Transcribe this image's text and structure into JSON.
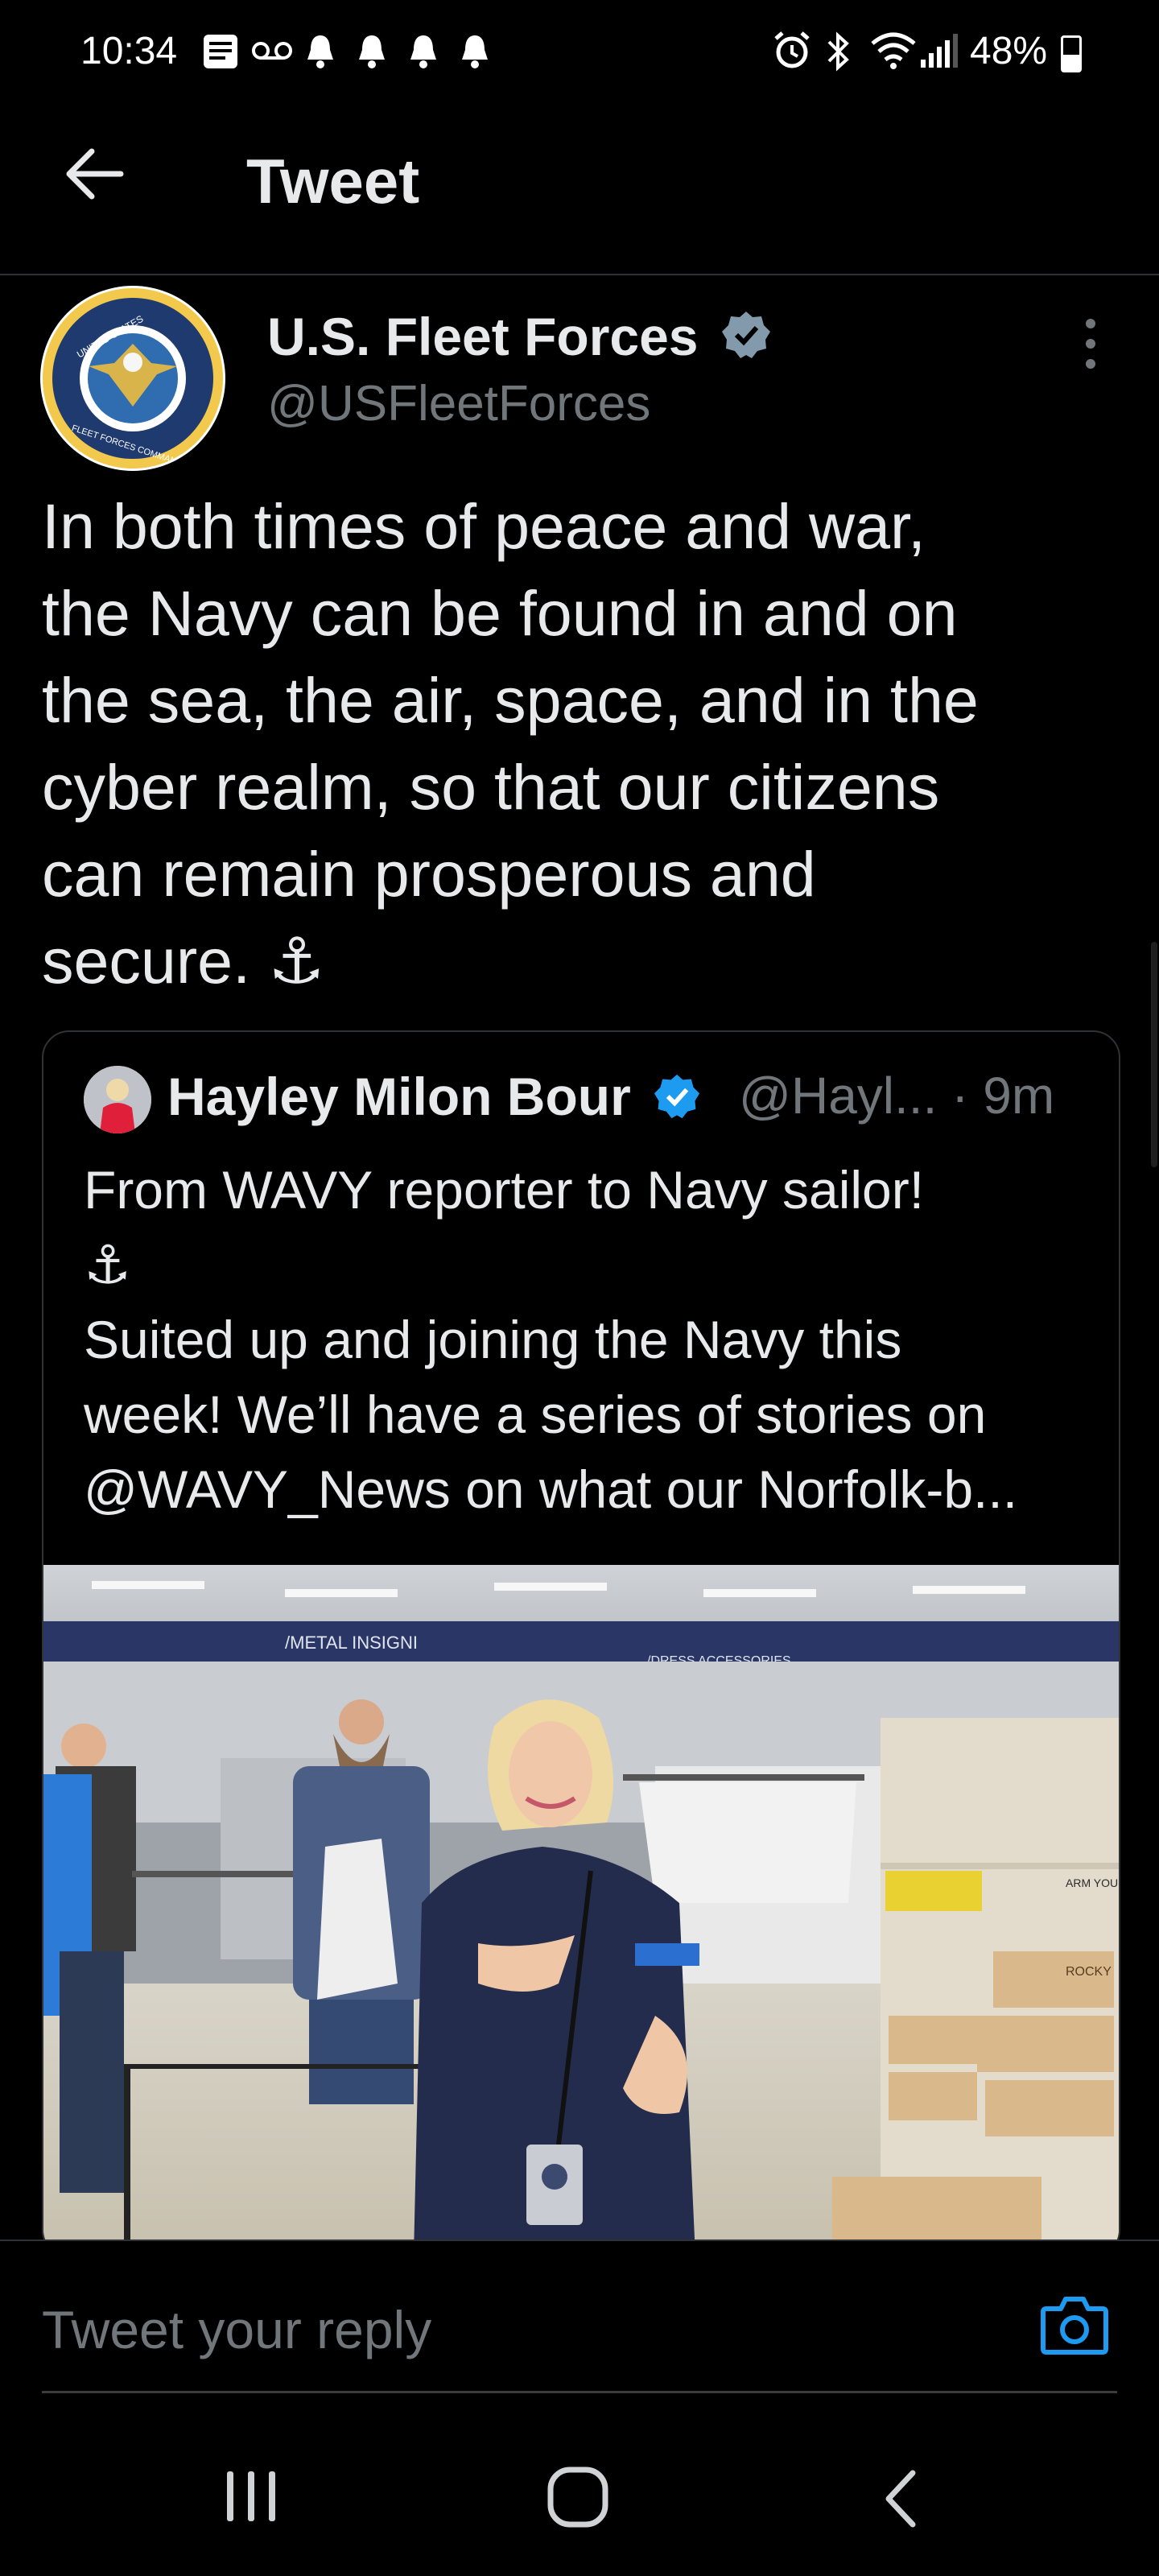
{
  "status_bar": {
    "time": "10:34",
    "battery": "48%",
    "battery_level": 0.48,
    "icons": [
      "message-icon",
      "voicemail-icon",
      "bell-icon",
      "bell-icon",
      "bell-icon",
      "bell-icon",
      "alarm-icon",
      "bluetooth-icon",
      "wifi-icon",
      "signal-icon",
      "battery-icon"
    ]
  },
  "header": {
    "title": "Tweet",
    "back_icon": "back-arrow-icon"
  },
  "tweet": {
    "author_name": "U.S. Fleet Forces",
    "author_handle": "@USFleetForces",
    "avatar_text_top": "UNITED STATES",
    "avatar_text_bottom": "FLEET FORCES COMMAND",
    "text_lines": [
      "In both times of peace and war,",
      "the Navy can be found in and on",
      "the sea, the air, space, and in the",
      "cyber realm, so that our citizens",
      "can remain prosperous and",
      "secure. ⚓"
    ],
    "verified_color": "#829aab"
  },
  "quote": {
    "author_name": "Hayley Milon Bour",
    "meta": "@Hayl... · 9m",
    "text_lines": [
      "From WAVY reporter to  Navy sailor!",
      "⚓",
      "Suited up and joining the Navy this",
      "week! We’ll have a series of stories on",
      "@WAVY_News on what our Norfolk-b..."
    ],
    "verified_color": "#1d9bf0",
    "photo_signs": [
      "/METAL INSIGNI",
      "/DRESS  ACCESSORIES",
      "ROCKY",
      "ARM YOUR FEET"
    ]
  },
  "reply": {
    "placeholder": "Tweet your reply",
    "accent": "#1d9bf0"
  },
  "nav": {
    "recents_icon": "recents-icon",
    "home_icon": "home-icon",
    "back_icon": "back-icon"
  }
}
